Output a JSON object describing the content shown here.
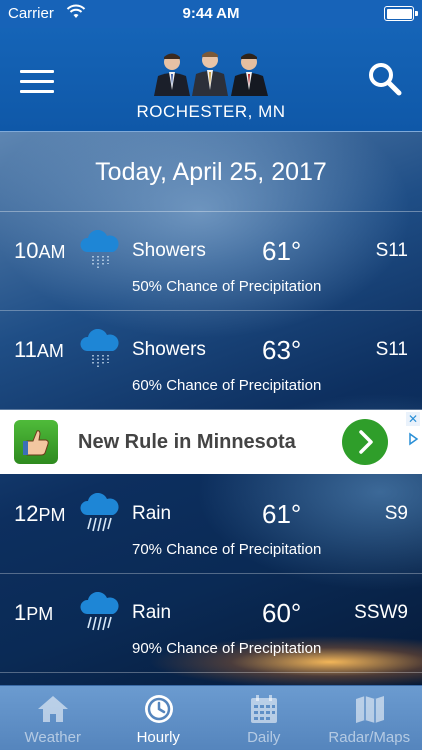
{
  "status_bar": {
    "carrier": "Carrier",
    "time": "9:44 AM"
  },
  "header": {
    "location": "ROCHESTER, MN",
    "logo_icon": "meteorologists-photo",
    "menu_icon": "hamburger-menu-icon",
    "search_icon": "search-icon"
  },
  "date_header": "Today, April 25, 2017",
  "hourly": [
    {
      "hour": "10",
      "ampm": "AM",
      "icon": "showers-icon",
      "condition": "Showers",
      "temp": "61°",
      "wind": "S11",
      "precip": "50% Chance of Precipitation"
    },
    {
      "hour": "11",
      "ampm": "AM",
      "icon": "showers-icon",
      "condition": "Showers",
      "temp": "63°",
      "wind": "S11",
      "precip": "60% Chance of Precipitation"
    },
    {
      "hour": "12",
      "ampm": "PM",
      "icon": "rain-icon",
      "condition": "Rain",
      "temp": "61°",
      "wind": "S9",
      "precip": "70% Chance of Precipitation"
    },
    {
      "hour": "1",
      "ampm": "PM",
      "icon": "rain-icon",
      "condition": "Rain",
      "temp": "60°",
      "wind": "SSW9",
      "precip": "90% Chance of Precipitation"
    }
  ],
  "ad": {
    "text": "New Rule in Minnesota"
  },
  "tabs": [
    {
      "label": "Weather",
      "icon": "home-icon",
      "active": false
    },
    {
      "label": "Hourly",
      "icon": "clock-icon",
      "active": true
    },
    {
      "label": "Daily",
      "icon": "calendar-icon",
      "active": false
    },
    {
      "label": "Radar/Maps",
      "icon": "map-icon",
      "active": false
    }
  ],
  "colors": {
    "header_blue": "#1564b7",
    "tab_bar": "#6b9bd0",
    "ad_green": "#2f9e2a"
  }
}
